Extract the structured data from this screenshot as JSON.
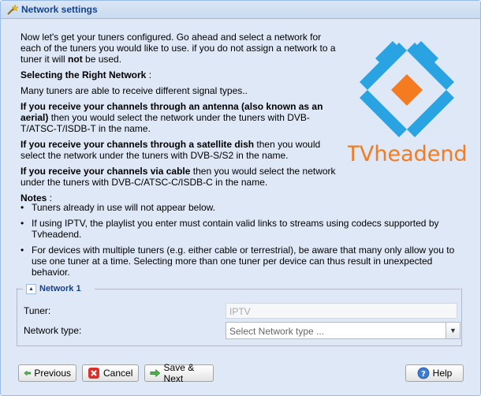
{
  "window": {
    "title": "Network settings"
  },
  "intro": {
    "para1": "Now let's get your tuners configured. Go ahead and select a network for each of the tuners you would like to use. if you do not assign a network to a tuner it will ",
    "para1_bold": "not",
    "para1_end": " be used.",
    "heading": "Selecting the Right Network",
    "heading_suffix": " :",
    "para2": "Many tuners are able to receive different signal types..",
    "antenna_bold": "If you receive your channels through an antenna (also known as an aerial)",
    "antenna_text": " then you would select the network under the tuners with DVB-T/ATSC-T/ISDB-T in the name.",
    "satellite_bold": "If you receive your channels through a satellite dish",
    "satellite_text": " then you would select the network under the tuners with DVB-S/S2 in the name.",
    "cable_bold": "If you receive your channels via cable",
    "cable_text": " then you would select the network under the tuners with DVB-C/ATSC-C/ISDB-C in the name.",
    "notes_heading": "Notes",
    "notes_suffix": " :"
  },
  "notes": [
    "Tuners already in use will not appear below.",
    "If using IPTV, the playlist you enter must contain valid links to streams using codecs supported by Tvheadend.",
    "For devices with multiple tuners (e.g. either cable or terrestrial), be aware that many only allow you to use one tuner at a time. Selecting more than one tuner per device can thus result in unexpected behavior."
  ],
  "logo": {
    "text": "TVheadend"
  },
  "network": {
    "legend": "Network 1",
    "tuner_label": "Tuner:",
    "tuner_value": "IPTV",
    "type_label": "Network type:",
    "type_placeholder": "Select Network type ..."
  },
  "buttons": {
    "previous": "Previous",
    "cancel": "Cancel",
    "save_next": "Save & Next",
    "help": "Help"
  },
  "colors": {
    "accent": "#15428b",
    "logo_orange": "#f47b20",
    "logo_blue": "#2aa3e3"
  }
}
